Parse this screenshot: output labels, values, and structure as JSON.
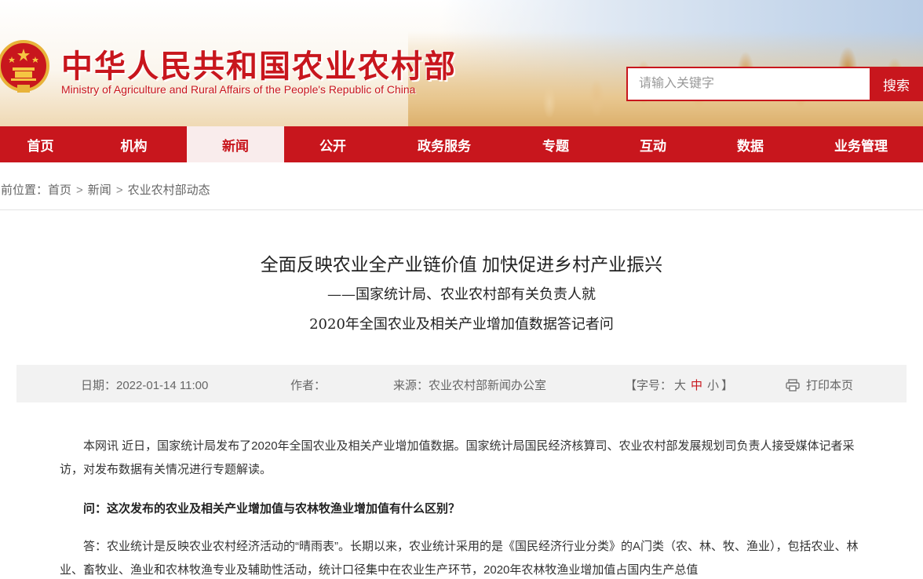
{
  "header": {
    "site_title": "中华人民共和国农业农村部",
    "site_subtitle": "Ministry of Agriculture and Rural Affairs of the People's Republic of China",
    "search_placeholder": "请输入关键字",
    "search_button": "搜索",
    "brand_color": "#c8161d",
    "emblem_icon": "national-emblem-icon"
  },
  "nav": {
    "items": [
      {
        "label": "首页"
      },
      {
        "label": "机构"
      },
      {
        "label": "新闻"
      },
      {
        "label": "公开"
      },
      {
        "label": "政务服务"
      },
      {
        "label": "专题"
      },
      {
        "label": "互动"
      },
      {
        "label": "数据"
      },
      {
        "label": "业务管理"
      }
    ],
    "active": "新闻"
  },
  "breadcrumb": {
    "prefix": "当前位置：",
    "items": [
      "首页",
      "新闻",
      "农业农村部动态"
    ],
    "separator": ">"
  },
  "article": {
    "title": "全面反映农业全产业链价值 加快促进乡村产业振兴",
    "subtitle_line1": "——国家统计局、农业农村部有关负责人就",
    "subtitle_line2": "2020年全国农业及相关产业增加值数据答记者问",
    "info": {
      "date": "日期：2022-01-14 11:00",
      "author": "作者：",
      "source": "来源：农业农村部新闻办公室",
      "fontsize_open": "【字号：",
      "fontsize_large": "大",
      "fontsize_medium": "中",
      "fontsize_small": "小",
      "fontsize_close": "】",
      "print": "打印本页"
    },
    "paragraphs": [
      "本网讯 近日，国家统计局发布了2020年全国农业及相关产业增加值数据。国家统计局国民经济核算司、农业农村部发展规划司负责人接受媒体记者采访，对发布数据有关情况进行专题解读。",
      "问：这次发布的农业及相关产业增加值与农林牧渔业增加值有什么区别？",
      "答：农业统计是反映农业农村经济活动的“晴雨表”。长期以来，农业统计采用的是《国民经济行业分类》的A门类（农、林、牧、渔业），包括农业、林业、畜牧业、渔业和农林牧渔专业及辅助性活动，统计口径集中在农业生产环节，2020年农林牧渔业增加值占国内生产总值"
    ]
  }
}
